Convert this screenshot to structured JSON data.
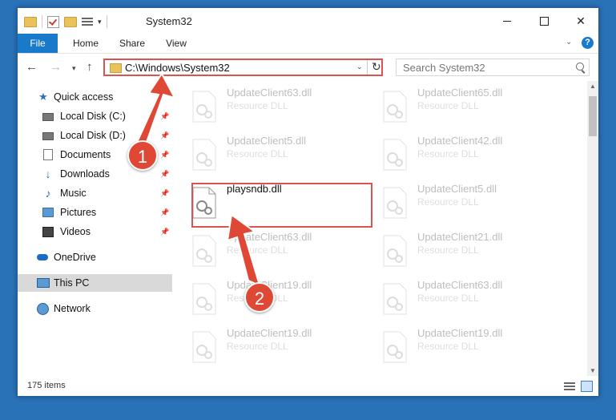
{
  "window": {
    "title": "System32"
  },
  "ribbon": {
    "tabs": [
      {
        "label": "File"
      },
      {
        "label": "Home"
      },
      {
        "label": "Share"
      },
      {
        "label": "View"
      }
    ]
  },
  "address": {
    "path": "C:\\Windows\\System32"
  },
  "search": {
    "placeholder": "Search System32"
  },
  "sidebar": {
    "items": [
      {
        "label": "Quick access"
      },
      {
        "label": "Local Disk (C:)"
      },
      {
        "label": "Local Disk (D:)"
      },
      {
        "label": "Documents"
      },
      {
        "label": "Downloads"
      },
      {
        "label": "Music"
      },
      {
        "label": "Pictures"
      },
      {
        "label": "Videos"
      },
      {
        "label": "OneDrive"
      },
      {
        "label": "This PC"
      },
      {
        "label": "Network"
      }
    ]
  },
  "files": [
    {
      "name": "UpdateClient63.dll",
      "type": "Resource DLL"
    },
    {
      "name": "UpdateClient65.dll",
      "type": "Resource DLL"
    },
    {
      "name": "UpdateClient5.dll",
      "type": "Resource DLL"
    },
    {
      "name": "UpdateClient42.dll",
      "type": "Resource DLL"
    },
    {
      "name": "playsndb.dll",
      "type": ""
    },
    {
      "name": "UpdateClient5.dll",
      "type": "Resource DLL"
    },
    {
      "name": "UpdateClient63.dll",
      "type": "Resource DLL"
    },
    {
      "name": "UpdateClient21.dll",
      "type": "Resource DLL"
    },
    {
      "name": "UpdateClient19.dll",
      "type": "Resource DLL"
    },
    {
      "name": "UpdateClient63.dll",
      "type": "Resource DLL"
    },
    {
      "name": "UpdateClient19.dll",
      "type": "Resource DLL"
    },
    {
      "name": "UpdateClient19.dll",
      "type": "Resource DLL"
    }
  ],
  "status": {
    "item_count": "175 items"
  },
  "annotations": {
    "step1": "1",
    "step2": "2",
    "color": "#e04836"
  }
}
